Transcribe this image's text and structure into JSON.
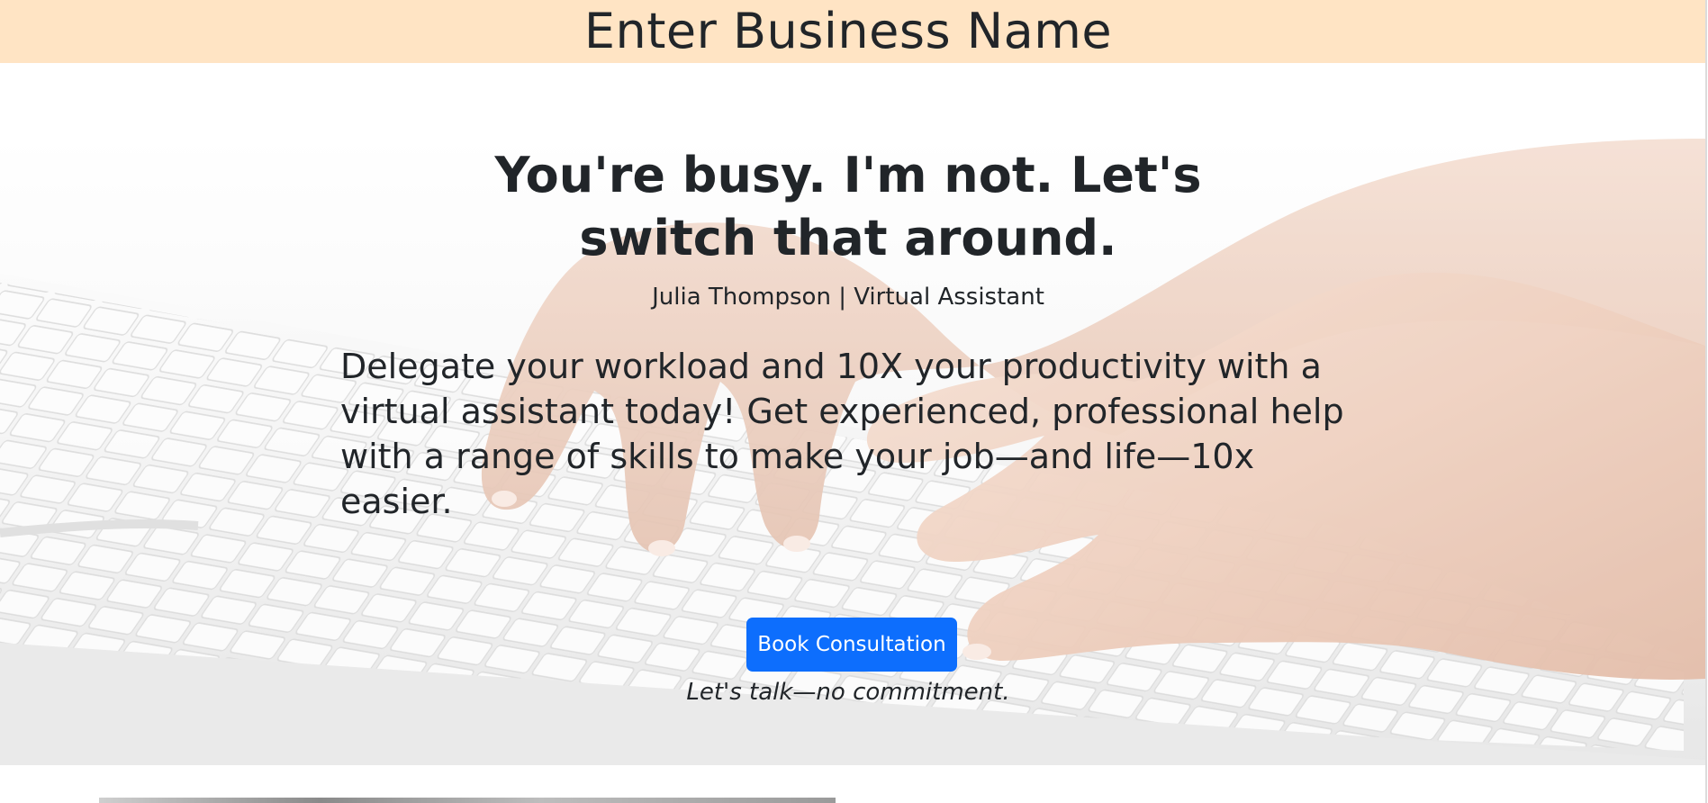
{
  "header": {
    "business_name": "Enter Business Name"
  },
  "hero": {
    "headline_line1": "You're busy. I'm not. Let's",
    "headline_line2": "switch that around.",
    "byline": "Julia Thompson | Virtual Assistant",
    "lead": "Delegate your workload and 10X your productivity with a virtual assistant today! Get experienced, professional help with a range of skills to make your job—and life—10x easier.",
    "cta_label": "Book Consultation",
    "cta_note": "Let's talk—no commitment."
  },
  "colors": {
    "header_bg": "#ffe4c4",
    "cta_bg": "#0d6efd",
    "text": "#212529"
  },
  "icons": {
    "hero_image": "hands-typing-on-keyboard-image"
  }
}
